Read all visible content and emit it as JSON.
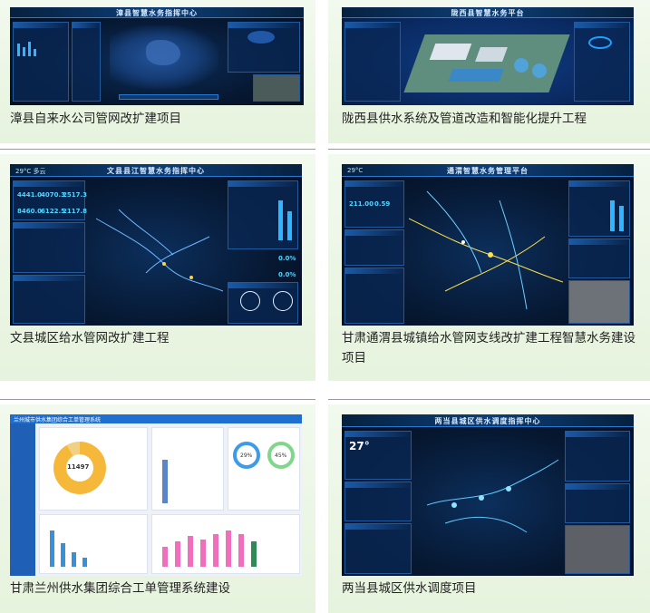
{
  "cards": [
    {
      "caption": "漳县自来水公司管网改扩建项目",
      "screen_title": "漳县智慧水务指挥中心"
    },
    {
      "caption": "陇西县供水系统及管道改造和智能化提升工程",
      "screen_title": "陇西县智慧水务平台"
    },
    {
      "caption": "文县城区给水管网改扩建工程",
      "screen_title": "文县县江智慧水务指挥中心",
      "temp": "29°C 多云"
    },
    {
      "caption": "甘肃通渭县城镇给水管网支线改扩建工程智慧水务建设项目",
      "screen_title": "通渭智慧水务管理平台",
      "temp": "29°C"
    },
    {
      "caption": "甘肃兰州供水集团综合工单管理系统建设",
      "screen_title": "兰州城市供水集团综合工单管理系统",
      "donut_value": "11497",
      "ring1": "29%",
      "ring2": "45%"
    },
    {
      "caption": "两当县城区供水调度项目",
      "screen_title": "两当县城区供水调度指挥中心",
      "temp": "27°"
    }
  ],
  "colors": {
    "card_bg": "#eef7e8",
    "separator": "#9a9a9a",
    "dash_bg": "#061730",
    "accent": "#2fb6ff"
  }
}
